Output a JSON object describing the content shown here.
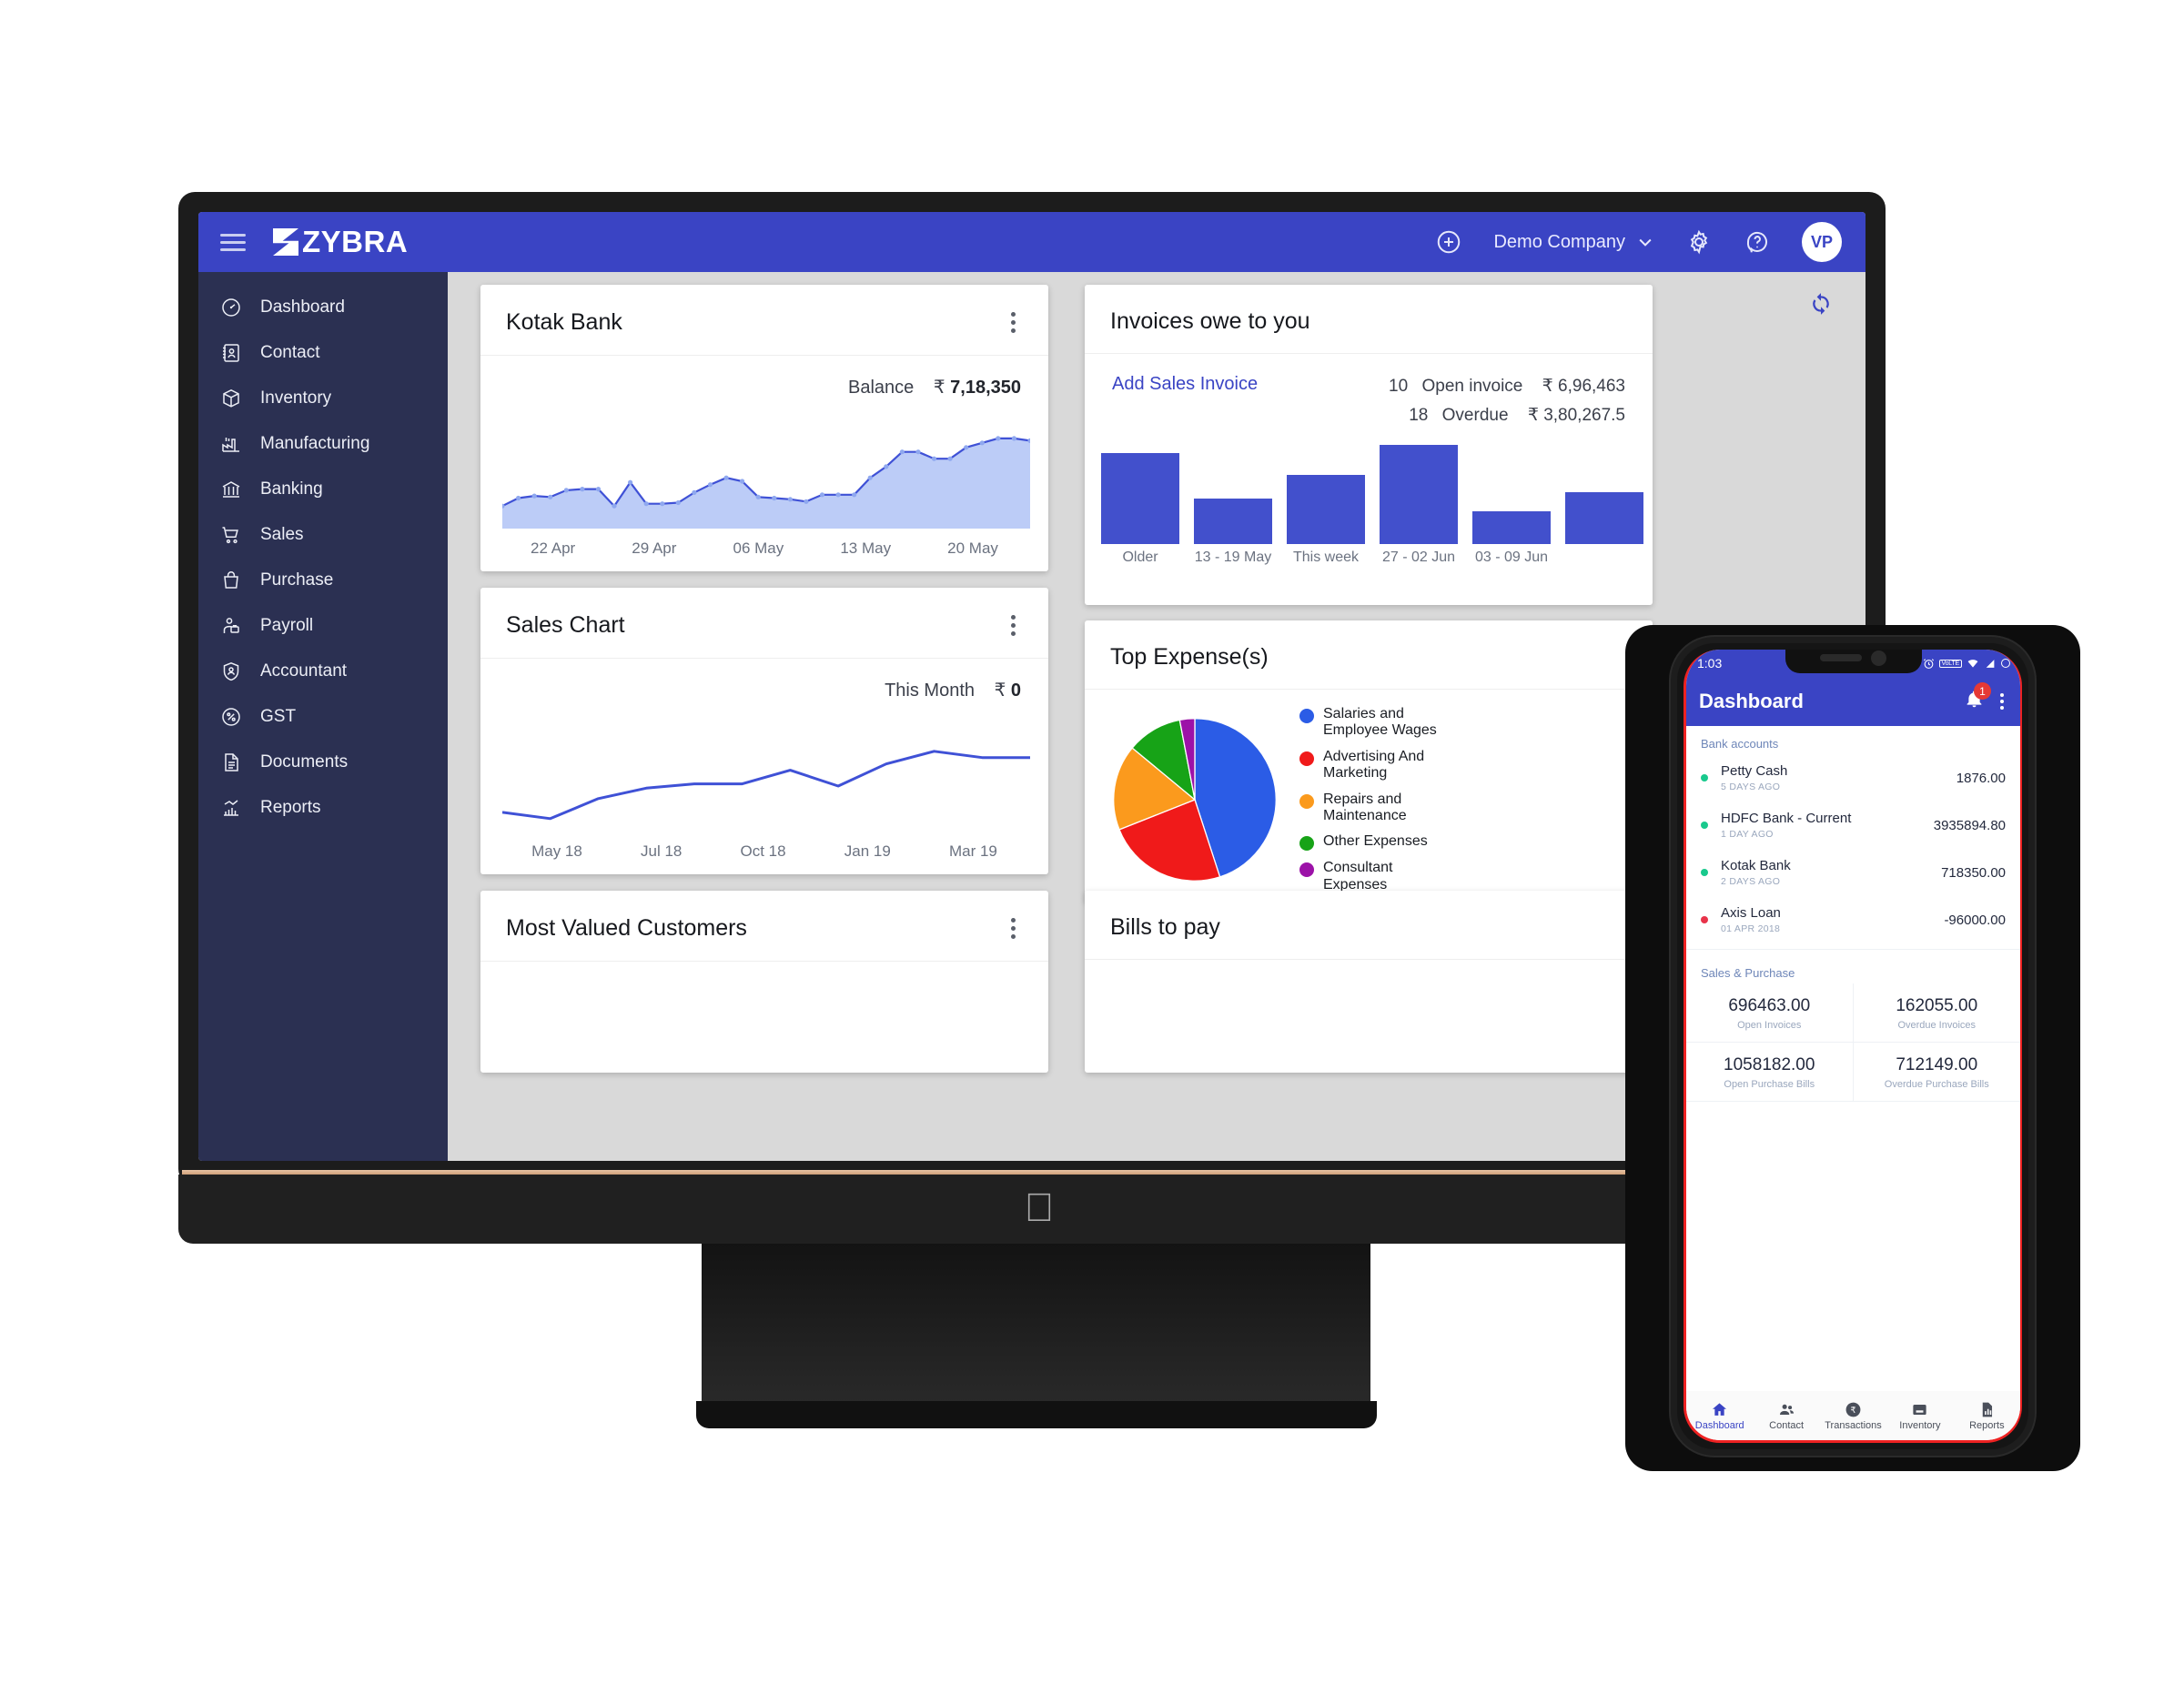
{
  "brand": {
    "name": "ZYBRA"
  },
  "topbar": {
    "add_icon": "plus-circle-icon",
    "company": "Demo Company",
    "settings_icon": "gear-icon",
    "help_icon": "help-icon",
    "avatar_initials": "VP"
  },
  "sidebar": {
    "items": [
      {
        "label": "Dashboard",
        "icon": "speedometer-icon"
      },
      {
        "label": "Contact",
        "icon": "contact-book-icon"
      },
      {
        "label": "Inventory",
        "icon": "box-icon"
      },
      {
        "label": "Manufacturing",
        "icon": "factory-icon"
      },
      {
        "label": "Banking",
        "icon": "bank-icon"
      },
      {
        "label": "Sales",
        "icon": "cart-icon"
      },
      {
        "label": "Purchase",
        "icon": "bag-icon"
      },
      {
        "label": "Payroll",
        "icon": "payroll-icon"
      },
      {
        "label": "Accountant",
        "icon": "shield-user-icon"
      },
      {
        "label": "GST",
        "icon": "percent-icon"
      },
      {
        "label": "Documents",
        "icon": "document-icon"
      },
      {
        "label": "Reports",
        "icon": "bar-chart-icon"
      }
    ]
  },
  "content": {
    "refresh_icon": "refresh-icon",
    "kebab_icon": "kebab-menu-icon",
    "cards": {
      "kotak": {
        "title": "Kotak Bank",
        "balance_label": "Balance",
        "currency": "₹",
        "balance_value": "7,18,350"
      },
      "sales": {
        "title": "Sales Chart",
        "period_label": "This Month",
        "currency": "₹",
        "value": "0"
      },
      "invoices": {
        "title": "Invoices owe to you",
        "add_link": "Add Sales Invoice",
        "stats": [
          {
            "count": "10",
            "label": "Open invoice",
            "currency": "₹",
            "amount": "6,96,463"
          },
          {
            "count": "18",
            "label": "Overdue",
            "currency": "₹",
            "amount": "3,80,267.5"
          }
        ]
      },
      "expense": {
        "title": "Top Expense(s)"
      },
      "mvc": {
        "title": "Most Valued Customers"
      },
      "bills": {
        "title": "Bills to pay"
      }
    }
  },
  "chart_data": [
    {
      "id": "kotak_bank_balance",
      "type": "area",
      "title": "Kotak Bank",
      "xlabel": "",
      "ylabel": "Balance",
      "grid": false,
      "legend": "none",
      "line_color": "#3f51d6",
      "fill_color": "#bcccf7",
      "tick_labels": [
        "22 Apr",
        "29 Apr",
        "06 May",
        "13 May",
        "20 May"
      ],
      "x": [
        0,
        1,
        2,
        3,
        4,
        5,
        6,
        7,
        8,
        9,
        10,
        11,
        12,
        13,
        14,
        15,
        16,
        17,
        18,
        19,
        20,
        21,
        22,
        23,
        24,
        25,
        26,
        27,
        28,
        29,
        30,
        31
      ],
      "values": [
        20,
        27,
        29,
        28,
        34,
        35,
        35,
        20,
        41,
        22,
        22,
        23,
        32,
        39,
        45,
        42,
        28,
        27,
        26,
        24,
        30,
        30,
        30,
        45,
        55,
        68,
        68,
        62,
        62,
        72,
        76,
        80,
        80,
        78
      ],
      "ylim": [
        0,
        100
      ]
    },
    {
      "id": "sales_chart",
      "type": "line",
      "title": "Sales Chart",
      "xlabel": "",
      "ylabel": "",
      "grid": false,
      "legend": "none",
      "line_color": "#3f51d6",
      "tick_labels": [
        "May 18",
        "Jul 18",
        "Oct 18",
        "Jan 19",
        "Mar 19"
      ],
      "categories": [
        "May 18",
        "Jun 18",
        "Jul 18",
        "Aug 18",
        "Sep 18",
        "Oct 18",
        "Nov 18",
        "Dec 18",
        "Jan 19",
        "Feb 19",
        "Mar 19",
        "Apr 19"
      ],
      "values": [
        20,
        14,
        33,
        43,
        47,
        47,
        60,
        45,
        66,
        78,
        72,
        72
      ],
      "ylim": [
        0,
        100
      ]
    },
    {
      "id": "invoices_owe_to_you",
      "type": "bar",
      "title": "Invoices owe to you",
      "xlabel": "",
      "ylabel": "",
      "grid": false,
      "legend": "none",
      "bar_color": "#4250cc",
      "categories": [
        "Older",
        "13 - 19 May",
        "This week",
        "27 - 02 Jun",
        "03 - 09 Jun",
        ""
      ],
      "values": [
        92,
        46,
        70,
        100,
        33,
        52
      ],
      "ylim": [
        0,
        110
      ]
    },
    {
      "id": "top_expenses",
      "type": "pie",
      "title": "Top Expense(s)",
      "legend": "right",
      "labels": [
        "Salaries and Employee Wages",
        "Advertising And Marketing",
        "Repairs and Maintenance",
        "Other Expenses",
        "Consultant Expenses"
      ],
      "colors": [
        "#2b5ce6",
        "#f01a1a",
        "#fb9a1d",
        "#17a317",
        "#9c12a8"
      ],
      "values": [
        45,
        24,
        17,
        11,
        3
      ]
    }
  ],
  "phone": {
    "status": {
      "time": "1:03",
      "icons": [
        "alarm-icon",
        "volte-icon",
        "wifi-icon",
        "signal-icon",
        "battery-icon"
      ]
    },
    "appbar": {
      "title": "Dashboard",
      "bell_icon": "bell-icon",
      "badge": "1",
      "kebab_icon": "kebab-menu-icon"
    },
    "bank_section_label": "Bank accounts",
    "accounts": [
      {
        "name": "Petty Cash",
        "sub": "5 DAYS AGO",
        "amount": "1876.00",
        "dot": "#19c98d"
      },
      {
        "name": "HDFC Bank - Current",
        "sub": "1 DAY AGO",
        "amount": "3935894.80",
        "dot": "#19c98d"
      },
      {
        "name": "Kotak Bank",
        "sub": "2 DAYS AGO",
        "amount": "718350.00",
        "dot": "#19c98d"
      },
      {
        "name": "Axis Loan",
        "sub": "01 APR 2018",
        "amount": "-96000.00",
        "dot": "#e8334a"
      }
    ],
    "sp_section_label": "Sales & Purchase",
    "sp_cells": [
      {
        "value": "696463.00",
        "caption": "Open Invoices"
      },
      {
        "value": "162055.00",
        "caption": "Overdue Invoices"
      },
      {
        "value": "1058182.00",
        "caption": "Open Purchase Bills"
      },
      {
        "value": "712149.00",
        "caption": "Overdue Purchase Bills"
      }
    ],
    "nav": [
      {
        "label": "Dashboard",
        "icon": "home-icon",
        "active": true
      },
      {
        "label": "Contact",
        "icon": "people-icon",
        "active": false
      },
      {
        "label": "Transactions",
        "icon": "rupee-circle-icon",
        "active": false
      },
      {
        "label": "Inventory",
        "icon": "inventory-box-icon",
        "active": false
      },
      {
        "label": "Reports",
        "icon": "report-chart-icon",
        "active": false
      }
    ]
  },
  "colors": {
    "brand_blue": "#3a44c4",
    "sidebar_navy": "#2b3052",
    "content_bg": "#d9d9d9",
    "chart_blue": "#3f51d6",
    "bar_blue": "#4250cc"
  }
}
